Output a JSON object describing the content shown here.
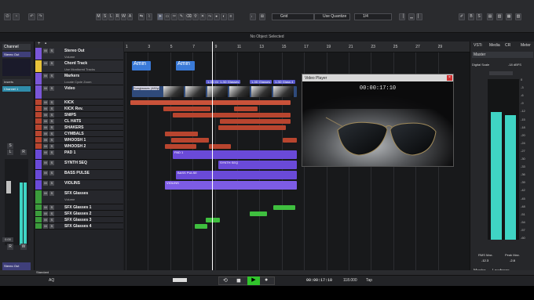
{
  "toolbar": {
    "left_buttons": [
      "M",
      "S",
      "L",
      "R",
      "W",
      "A"
    ],
    "right_buttons": [
      "B",
      "S"
    ],
    "grid_label": "Grid",
    "quantize_label": "Use Quantize",
    "quantize_value": "1/4"
  },
  "info_line": "No Object Selected",
  "inspector": {
    "tabs": [
      "Channel"
    ],
    "channel_name": "Stereo Out",
    "inserts_label": "Inserts",
    "insert_slot": "Channel 1",
    "fader_buttons": [
      "S",
      "L",
      "R"
    ],
    "bottom_buttons": [
      "R",
      "W"
    ],
    "bottom_name": "Stereo Out",
    "fader_value": "0.00"
  },
  "tracks": [
    {
      "name": "Stereo Out",
      "color": "#7a56d8",
      "height": 16,
      "sub": "Volume"
    },
    {
      "name": "Chord Track",
      "color": "#e8c33a",
      "height": 16,
      "sub": "Use Monitored Tracks"
    },
    {
      "name": "Markers",
      "color": "#7a56d8",
      "height": 16,
      "sub": "Locate  Cycle  Zoom"
    },
    {
      "name": "Video",
      "color": "#7a56d8",
      "height": 18,
      "sub": ""
    },
    {
      "name": "KICK",
      "color": "#b8452f",
      "height": 8
    },
    {
      "name": "KICK Rev.",
      "color": "#b8452f",
      "height": 8
    },
    {
      "name": "SNIPS",
      "color": "#b8452f",
      "height": 8
    },
    {
      "name": "CL HATS",
      "color": "#b8452f",
      "height": 8
    },
    {
      "name": "SHAKERS",
      "color": "#b8452f",
      "height": 8
    },
    {
      "name": "CYMBALS",
      "color": "#b8452f",
      "height": 8
    },
    {
      "name": "WHOOSH 1",
      "color": "#b8452f",
      "height": 8
    },
    {
      "name": "WHOOSH 2",
      "color": "#b8452f",
      "height": 8
    },
    {
      "name": "PAD 1",
      "color": "#6a4ad8",
      "height": 13
    },
    {
      "name": "SYNTH SEQ",
      "color": "#6a4ad8",
      "height": 13
    },
    {
      "name": "BASS PULSE",
      "color": "#6a4ad8",
      "height": 13
    },
    {
      "name": "VIOLINS",
      "color": "#6a4ad8",
      "height": 13
    },
    {
      "name": "SFX Glasses",
      "color": "#3b9b3b",
      "height": 18,
      "sub": "Volume"
    },
    {
      "name": "SFX Glasses 1",
      "color": "#3b9b3b",
      "height": 8
    },
    {
      "name": "SFX Glasses 2",
      "color": "#3b9b3b",
      "height": 8
    },
    {
      "name": "SFX Glasses 3",
      "color": "#3b9b3b",
      "height": 8
    },
    {
      "name": "SFX Glasses 4",
      "color": "#3b9b3b",
      "height": 8
    }
  ],
  "ruler": [
    "1",
    "3",
    "5",
    "7",
    "9",
    "11",
    "13",
    "15",
    "17",
    "19",
    "21",
    "23",
    "25",
    "27",
    "29"
  ],
  "chords": [
    "Amin",
    "Amin"
  ],
  "marker_labels": [
    "1-3D Glasses 1",
    "1-3D Glasses 2",
    "1-3D Glasses 3",
    "1-3D Glass 4"
  ],
  "video_clip_label": "Sunglasses (480p)",
  "clip_labels": {
    "pad": "PAD 1",
    "synth": "SYNTH SEQ",
    "bass": "BASS PULSE",
    "violins": "VIOLINS"
  },
  "video_player": {
    "title": "Video Player",
    "timecode": "00:00:17:10"
  },
  "right_zone": {
    "tabs": [
      "VSTi",
      "Media",
      "CR",
      "Meter"
    ],
    "master_label": "Master",
    "digital_scale": "Digital Scale",
    "scale_value": "-18 dBFS",
    "meter_marks": [
      "0",
      "-3",
      "-6",
      "-9",
      "-12",
      "-15",
      "-18",
      "-20",
      "-24",
      "-27",
      "-30",
      "-33",
      "-36",
      "-39",
      "-42",
      "-45",
      "-48",
      "-51",
      "-54",
      "-57",
      "-60"
    ],
    "rms_label": "RMS Max.",
    "peak_label": "Peak Max.",
    "rms_value": "-12.3",
    "peak_value": "-2.8",
    "bottom_tabs": [
      "Master",
      "Loudness"
    ]
  },
  "status_left": "Standard",
  "transport": {
    "aq_label": "AQ",
    "position": "00:00:17:10",
    "tempo": "118.000",
    "tap": "Tap"
  },
  "colors": {
    "audio": "#b8452f",
    "instrument": "#6a4ad8",
    "sfx": "#3b9b3b",
    "meter": "#3fd4c4"
  }
}
